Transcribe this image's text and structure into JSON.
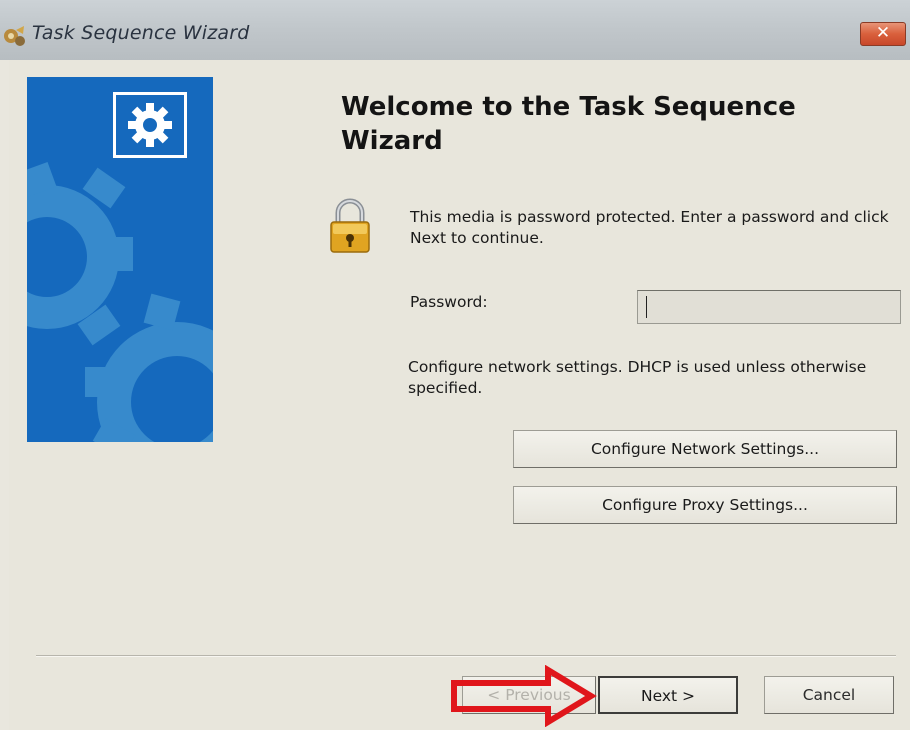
{
  "window": {
    "title": "Task Sequence Wizard",
    "close_label": "✕"
  },
  "main": {
    "heading": "Welcome to the Task Sequence Wizard",
    "intro": "This media is password protected.  Enter a password and click Next to continue.",
    "password_label": "Password:",
    "password_value": "",
    "network_text": "Configure network settings. DHCP is used unless otherwise specified.",
    "network_button": "Configure Network Settings...",
    "proxy_button": "Configure Proxy Settings..."
  },
  "footer": {
    "previous_button": "< Previous",
    "next_button": "Next >",
    "cancel_button": "Cancel"
  },
  "colors": {
    "side_panel": "#1569bd",
    "annotation_arrow": "#e0161b"
  },
  "icons": {
    "title": "wizard-app-icon",
    "side": "gear-icon",
    "lock": "padlock-icon",
    "annotation": "red-arrow-icon"
  }
}
